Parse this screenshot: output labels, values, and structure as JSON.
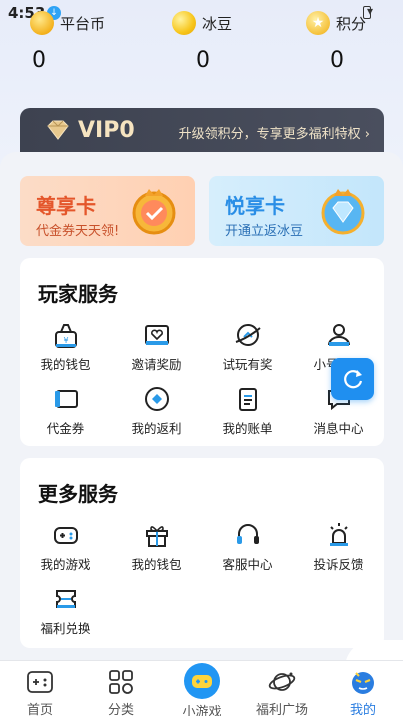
{
  "status": {
    "time": "4:53"
  },
  "stats": [
    {
      "label": "平台币",
      "value": "0",
      "icon": "platform-coin-icon"
    },
    {
      "label": "冰豆",
      "value": "0",
      "icon": "ice-bean-icon"
    },
    {
      "label": "积分",
      "value": "0",
      "icon": "points-star-icon"
    }
  ],
  "vip": {
    "title": "VIP0",
    "desc": "升级领积分，专享更多福利特权",
    "chevron": "›"
  },
  "promos": [
    {
      "title": "尊享卡",
      "subtitle": "代金券天天领!"
    },
    {
      "title": "悦享卡",
      "subtitle": "开通立返冰豆"
    }
  ],
  "player_services": {
    "title": "玩家服务",
    "items": [
      {
        "label": "我的钱包",
        "icon": "wallet-icon"
      },
      {
        "label": "邀请奖励",
        "icon": "invite-reward-icon"
      },
      {
        "label": "试玩有奖",
        "icon": "trial-play-icon"
      },
      {
        "label": "小号管理",
        "icon": "sub-account-icon"
      },
      {
        "label": "代金券",
        "icon": "coupon-icon"
      },
      {
        "label": "我的返利",
        "icon": "rebate-icon"
      },
      {
        "label": "我的账单",
        "icon": "bill-icon"
      },
      {
        "label": "消息中心",
        "icon": "message-icon"
      }
    ]
  },
  "more_services": {
    "title": "更多服务",
    "items": [
      {
        "label": "我的游戏",
        "icon": "gamepad-icon"
      },
      {
        "label": "我的钱包",
        "icon": "gift-icon"
      },
      {
        "label": "客服中心",
        "icon": "headset-icon"
      },
      {
        "label": "投诉反馈",
        "icon": "alarm-icon"
      },
      {
        "label": "福利兑换",
        "icon": "exchange-ticket-icon"
      }
    ]
  },
  "tabs": [
    {
      "label": "首页",
      "icon": "home-gamepad-icon"
    },
    {
      "label": "分类",
      "icon": "category-grid-icon"
    },
    {
      "label": "小游戏",
      "icon": "mini-game-icon"
    },
    {
      "label": "福利广场",
      "icon": "planet-icon"
    },
    {
      "label": "我的",
      "icon": "profile-face-icon",
      "active": true
    }
  ],
  "colors": {
    "accent": "#2196f3",
    "vip_gold": "#f3e2be",
    "promo_orange": "#e4562b",
    "promo_blue": "#2a8ee6"
  }
}
